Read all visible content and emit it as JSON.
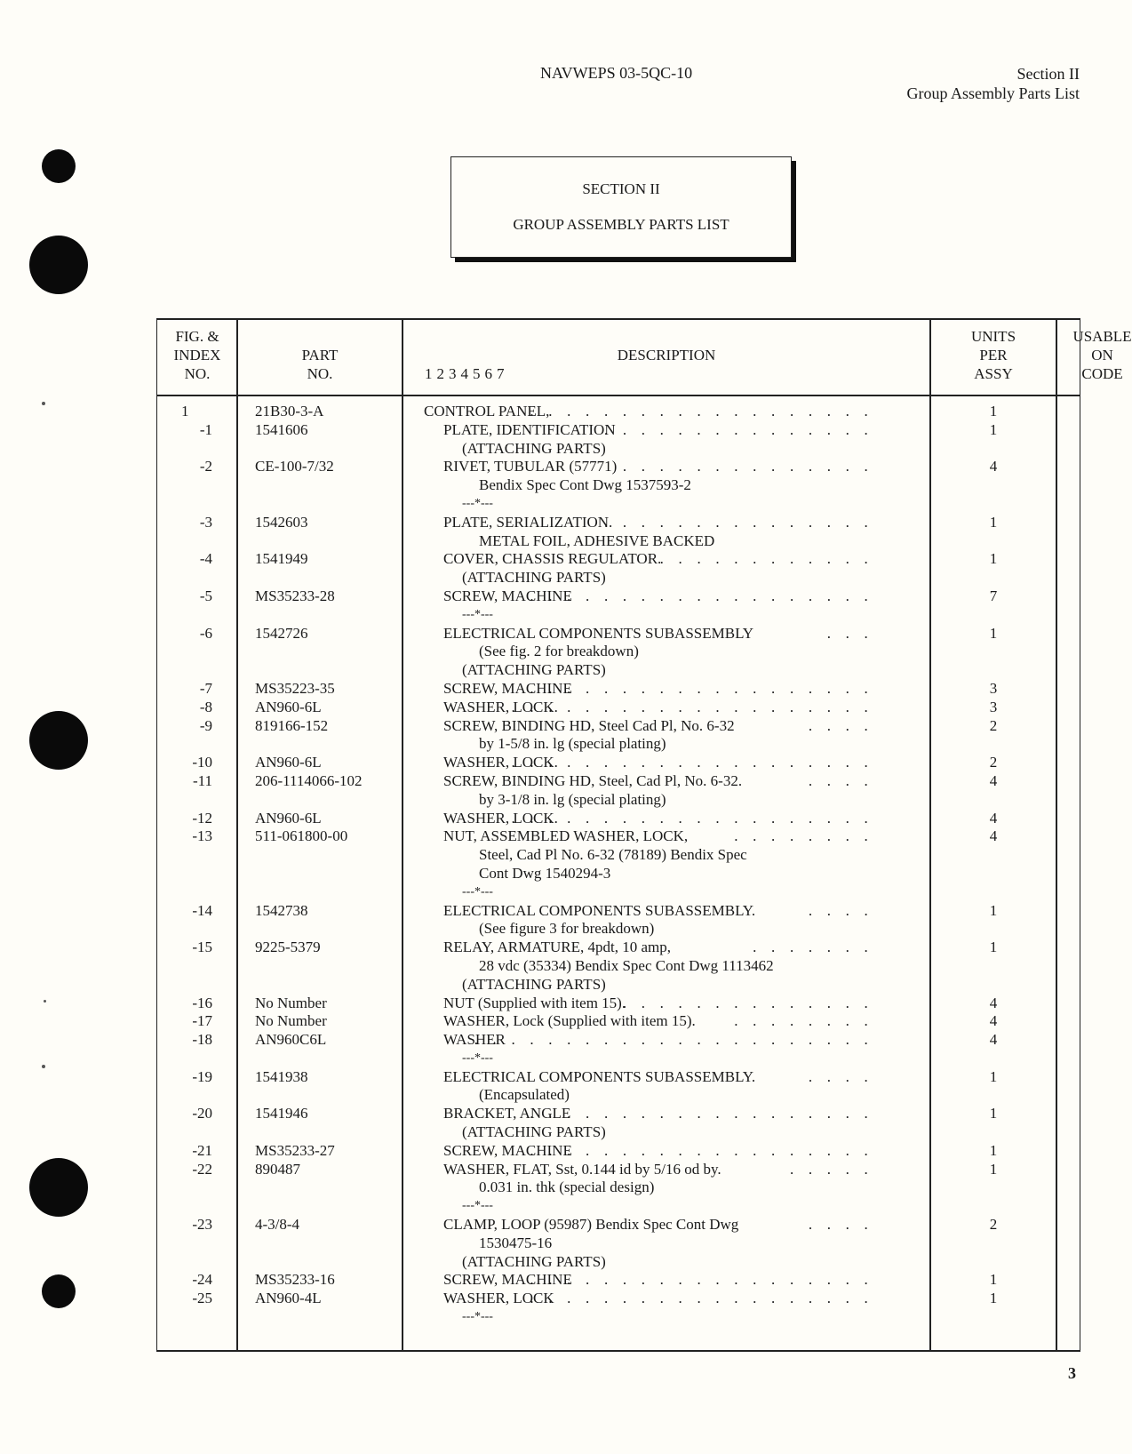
{
  "header": {
    "doc_number": "NAVWEPS 03-5QC-10",
    "section": "Section II",
    "section_title": "Group Assembly Parts List"
  },
  "section_box": {
    "line1": "SECTION II",
    "line2": "GROUP ASSEMBLY PARTS LIST"
  },
  "table": {
    "headers": {
      "fig_index": [
        "FIG. &",
        "INDEX",
        "NO."
      ],
      "part_no": [
        "PART",
        "NO."
      ],
      "description": "DESCRIPTION",
      "indent_levels": "1234567",
      "units_per_assy": [
        "UNITS",
        "PER",
        "ASSY"
      ],
      "usable_on_code": [
        "USABLE",
        "ON",
        "CODE"
      ]
    },
    "rows": [
      {
        "index": "1",
        "part": "21B30-3-A",
        "desc": "CONTROL PANEL,",
        "indent": 0,
        "dots": ". . . . . . . . . . . . . . . . . . .",
        "qty": "1"
      },
      {
        "index": "-1",
        "part": "1541606",
        "desc": "PLATE, IDENTIFICATION",
        "indent": 1,
        "dots": ". . . . . . . . . . . . . . .",
        "qty": "1"
      },
      {
        "index": "",
        "part": "",
        "desc": "(ATTACHING PARTS)",
        "indent": "ap",
        "dots": "",
        "qty": ""
      },
      {
        "index": "-2",
        "part": "CE-100-7/32",
        "desc": "RIVET, TUBULAR (57771)",
        "indent": 1,
        "dots": ". . . . . . . . . . . . . .",
        "qty": "4"
      },
      {
        "index": "",
        "part": "",
        "desc": "Bendix Spec Cont Dwg 1537593-2",
        "indent": 2,
        "dots": "",
        "qty": ""
      },
      {
        "index": "",
        "part": "",
        "desc": "---*---",
        "indent": "sep",
        "dots": "",
        "qty": ""
      },
      {
        "index": "-3",
        "part": "1542603",
        "desc": "PLATE, SERIALIZATION.",
        "indent": 1,
        "dots": ". . . . . . . . . . . . . . .",
        "qty": "1"
      },
      {
        "index": "",
        "part": "",
        "desc": "METAL FOIL, ADHESIVE BACKED",
        "indent": 2,
        "dots": "",
        "qty": ""
      },
      {
        "index": "-4",
        "part": "1541949",
        "desc": "COVER, CHASSIS REGULATOR.",
        "indent": 1,
        "dots": ". . . . . . . . . . . .",
        "qty": "1"
      },
      {
        "index": "",
        "part": "",
        "desc": "(ATTACHING PARTS)",
        "indent": "ap",
        "dots": "",
        "qty": ""
      },
      {
        "index": "-5",
        "part": "MS35233-28",
        "desc": "SCREW, MACHINE",
        "indent": 1,
        "dots": ". . . . . . . . . . . . . . . . . . .",
        "qty": "7"
      },
      {
        "index": "",
        "part": "",
        "desc": "---*---",
        "indent": "sep",
        "dots": "",
        "qty": ""
      },
      {
        "index": "-6",
        "part": "1542726",
        "desc": "ELECTRICAL COMPONENTS SUBASSEMBLY",
        "indent": 1,
        "dots": ". . .",
        "qty": "1"
      },
      {
        "index": "",
        "part": "",
        "desc": "(See fig. 2 for breakdown)",
        "indent": 2,
        "dots": "",
        "qty": ""
      },
      {
        "index": "",
        "part": "",
        "desc": "(ATTACHING PARTS)",
        "indent": "ap",
        "dots": "",
        "qty": ""
      },
      {
        "index": "-7",
        "part": "MS35223-35",
        "desc": "SCREW, MACHINE",
        "indent": 1,
        "dots": ". . . . . . . . . . . . . . . . . . .",
        "qty": "3"
      },
      {
        "index": "-8",
        "part": "AN960-6L",
        "desc": "WASHER, LOCK.",
        "indent": 1,
        "dots": ". . . . . . . . . . . . . . . . . . . .",
        "qty": "3"
      },
      {
        "index": "-9",
        "part": "819166-152",
        "desc": "SCREW, BINDING HD, Steel Cad Pl, No. 6-32",
        "indent": 1,
        "dots": ". . . .",
        "qty": "2"
      },
      {
        "index": "",
        "part": "",
        "desc": "by 1-5/8 in. lg (special plating)",
        "indent": 2,
        "dots": "",
        "qty": ""
      },
      {
        "index": "-10",
        "part": "AN960-6L",
        "desc": "WASHER, LOCK.",
        "indent": 1,
        "dots": ". . . . . . . . . . . . . . . . . . . .",
        "qty": "2"
      },
      {
        "index": "-11",
        "part": "206-1114066-102",
        "desc": "SCREW, BINDING HD, Steel, Cad Pl, No. 6-32.",
        "indent": 1,
        "dots": ". . . .",
        "qty": "4"
      },
      {
        "index": "",
        "part": "",
        "desc": "by 3-1/8 in. lg (special plating)",
        "indent": 2,
        "dots": "",
        "qty": ""
      },
      {
        "index": "-12",
        "part": "AN960-6L",
        "desc": "WASHER, LOCK.",
        "indent": 1,
        "dots": ". . . . . . . . . . . . . . . . . . . .",
        "qty": "4"
      },
      {
        "index": "-13",
        "part": "511-061800-00",
        "desc": "NUT, ASSEMBLED WASHER, LOCK,",
        "indent": 1,
        "dots": ". . . . . . . .",
        "qty": "4"
      },
      {
        "index": "",
        "part": "",
        "desc": "Steel, Cad Pl No. 6-32 (78189) Bendix Spec",
        "indent": 2,
        "dots": "",
        "qty": ""
      },
      {
        "index": "",
        "part": "",
        "desc": "Cont Dwg 1540294-3",
        "indent": 2,
        "dots": "",
        "qty": ""
      },
      {
        "index": "",
        "part": "",
        "desc": "---*---",
        "indent": "sep",
        "dots": "",
        "qty": ""
      },
      {
        "index": "-14",
        "part": "1542738",
        "desc": "ELECTRICAL COMPONENTS SUBASSEMBLY.",
        "indent": 1,
        "dots": ". . . .",
        "qty": "1"
      },
      {
        "index": "",
        "part": "",
        "desc": "(See figure 3 for breakdown)",
        "indent": 2,
        "dots": "",
        "qty": ""
      },
      {
        "index": "-15",
        "part": "9225-5379",
        "desc": "RELAY, ARMATURE,  4pdt, 10 amp,",
        "indent": 1,
        "dots": ". . . . . . .",
        "qty": "1"
      },
      {
        "index": "",
        "part": "",
        "desc": "28 vdc (35334) Bendix Spec Cont Dwg 1113462",
        "indent": 2,
        "dots": "",
        "qty": ""
      },
      {
        "index": "",
        "part": "",
        "desc": "(ATTACHING PARTS)",
        "indent": "ap",
        "dots": "",
        "qty": ""
      },
      {
        "index": "-16",
        "part": "No Number",
        "desc": "NUT (Supplied with item 15).",
        "indent": 1,
        "dots": ". . . . . . . . . . . . . .",
        "qty": "4"
      },
      {
        "index": "-17",
        "part": "No Number",
        "desc": "WASHER, Lock (Supplied with item 15).",
        "indent": 1,
        "dots": ". . . . . . . .",
        "qty": "4"
      },
      {
        "index": "-18",
        "part": "AN960C6L",
        "desc": "WASHER",
        "indent": 1,
        "dots": ". . . . . . . . . . . . . . . . . . . . . .",
        "qty": "4"
      },
      {
        "index": "",
        "part": "",
        "desc": "---*---",
        "indent": "sep",
        "dots": "",
        "qty": ""
      },
      {
        "index": "-19",
        "part": "1541938",
        "desc": "ELECTRICAL COMPONENTS SUBASSEMBLY.",
        "indent": 1,
        "dots": ". . . .",
        "qty": "1"
      },
      {
        "index": "",
        "part": "",
        "desc": "(Encapsulated)",
        "indent": 2,
        "dots": "",
        "qty": ""
      },
      {
        "index": "-20",
        "part": "1541946",
        "desc": "BRACKET, ANGLE",
        "indent": 1,
        "dots": ". . . . . . . . . . . . . . . . . . .",
        "qty": "1"
      },
      {
        "index": "",
        "part": "",
        "desc": "(ATTACHING PARTS)",
        "indent": "ap",
        "dots": "",
        "qty": ""
      },
      {
        "index": "-21",
        "part": "MS35233-27",
        "desc": "SCREW, MACHINE",
        "indent": 1,
        "dots": ". . . . . . . . . . . . . . . . . . .",
        "qty": "1"
      },
      {
        "index": "-22",
        "part": "890487",
        "desc": "WASHER, FLAT, Sst, 0.144 id by 5/16 od by.",
        "indent": 1,
        "dots": ". . . . .",
        "qty": "1"
      },
      {
        "index": "",
        "part": "",
        "desc": "0.031 in. thk (special design)",
        "indent": 2,
        "dots": "",
        "qty": ""
      },
      {
        "index": "",
        "part": "",
        "desc": "---*---",
        "indent": "sep",
        "dots": "",
        "qty": ""
      },
      {
        "index": "-23",
        "part": "4-3/8-4",
        "desc": "CLAMP, LOOP (95987) Bendix Spec Cont Dwg",
        "indent": 1,
        "dots": ". . . .",
        "qty": "2"
      },
      {
        "index": "",
        "part": "",
        "desc": "1530475-16",
        "indent": 2,
        "dots": "",
        "qty": ""
      },
      {
        "index": "",
        "part": "",
        "desc": "(ATTACHING PARTS)",
        "indent": "ap",
        "dots": "",
        "qty": ""
      },
      {
        "index": "-24",
        "part": "MS35233-16",
        "desc": "SCREW, MACHINE",
        "indent": 1,
        "dots": ". . . . . . . . . . . . . . . . . . .",
        "qty": "1"
      },
      {
        "index": "-25",
        "part": "AN960-4L",
        "desc": "WASHER, LOCK",
        "indent": 1,
        "dots": ". . . . . . . . . . . . . . . . . . .",
        "qty": "1"
      },
      {
        "index": "",
        "part": "",
        "desc": "---*---",
        "indent": "sep",
        "dots": "",
        "qty": ""
      }
    ]
  },
  "page_number": "3"
}
